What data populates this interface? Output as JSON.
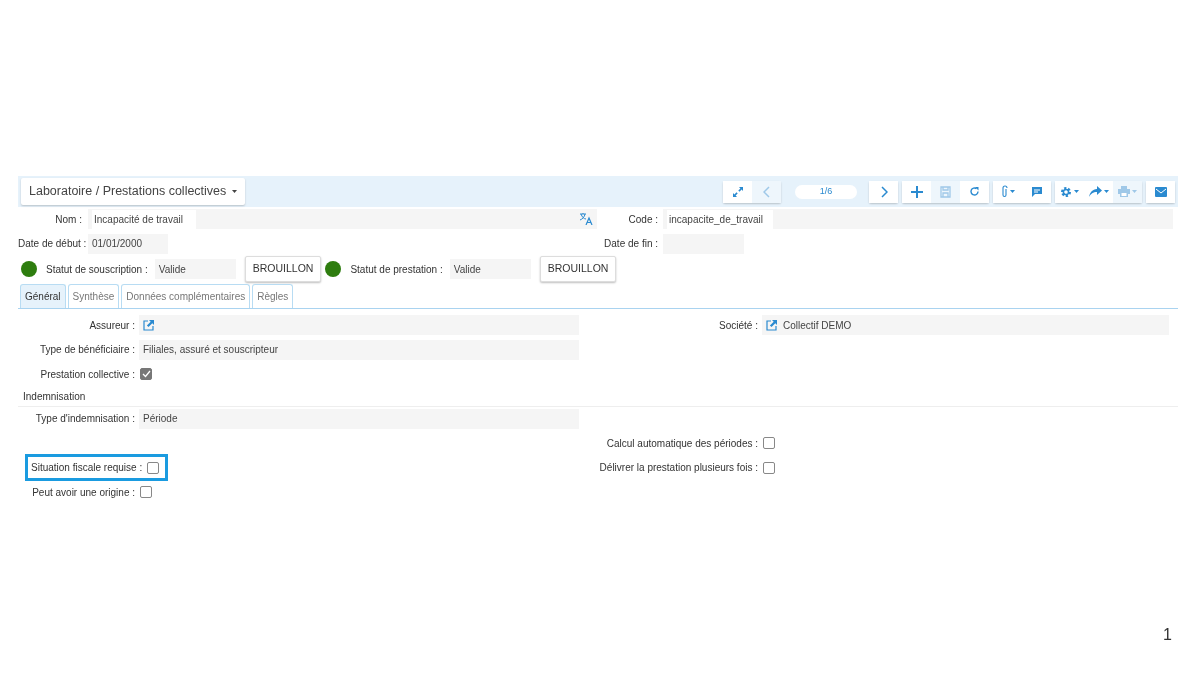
{
  "header": {
    "breadcrumb": "Laboratoire / Prestations collectives",
    "toolbar": {
      "pager": "1/6",
      "buttons": [
        {
          "disabled": false,
          "dropdown": false
        },
        {
          "disabled": true,
          "dropdown": false
        },
        {
          "disabled": false,
          "dropdown": false
        },
        {
          "disabled": false,
          "dropdown": false
        },
        {
          "disabled": true,
          "dropdown": false
        },
        {
          "disabled": false,
          "dropdown": false
        },
        {
          "disabled": false,
          "dropdown": true
        },
        {
          "disabled": false,
          "dropdown": false
        },
        {
          "disabled": false,
          "dropdown": true
        },
        {
          "disabled": false,
          "dropdown": true
        },
        {
          "disabled": true,
          "dropdown": true
        },
        {
          "disabled": false,
          "dropdown": false
        }
      ]
    }
  },
  "record": {
    "name_label": "Nom :",
    "name_value": "Incapacité de travail",
    "code_label": "Code :",
    "code_value": "incapacite_de_travail",
    "start_label": "Date de début :",
    "start_value": "01/01/2000",
    "end_label": "Date de fin :",
    "statuses": [
      {
        "label": "Statut de souscription :",
        "value": "Valide",
        "button": "BROUILLON",
        "color": "#2e7d0f"
      },
      {
        "label": "Statut de prestation :",
        "value": "Valide",
        "button": "BROUILLON",
        "color": "#2e7d0f"
      }
    ]
  },
  "tabs": [
    {
      "label": "Général",
      "selected": true
    },
    {
      "label": "Synthèse",
      "selected": false
    },
    {
      "label": "Données complémentaires",
      "selected": false
    },
    {
      "label": "Règles",
      "selected": false
    }
  ],
  "rows": [
    {
      "left": {
        "kind": "link",
        "label": "Assureur :"
      },
      "right": {
        "kind": "link",
        "label": "Société :",
        "value": "Collectif DEMO"
      }
    },
    {
      "left": {
        "kind": "text",
        "label": "Type de bénéficiaire :",
        "value": "Filiales, assuré et souscripteur"
      }
    },
    {
      "left": {
        "kind": "checkbox",
        "label": "Prestation collective :",
        "checked": true,
        "disabled": true
      }
    },
    {
      "section": "Indemnisation"
    },
    {
      "left": {
        "kind": "text",
        "label": "Type d'indemnisation :",
        "value": "Période"
      }
    },
    {
      "right": {
        "kind": "checkbox",
        "label": "Calcul automatique des périodes :",
        "checked": false
      }
    },
    {
      "left": {
        "kind": "checkbox",
        "label": "Situation fiscale requise :",
        "checked": false,
        "highlighted": true
      },
      "right": {
        "kind": "checkbox",
        "label": "Délivrer la prestation plusieurs fois :",
        "checked": false
      }
    },
    {
      "left": {
        "kind": "checkbox",
        "label": "Peut avoir une origine :",
        "checked": false
      }
    }
  ],
  "page_number": "1"
}
